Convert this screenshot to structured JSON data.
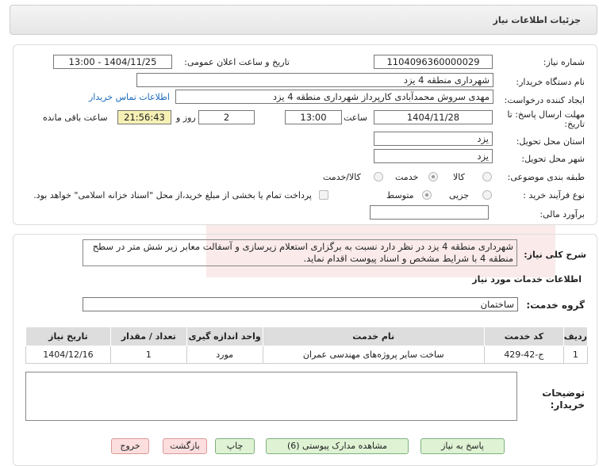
{
  "header": {
    "title": "جزئیات اطلاعات نیاز"
  },
  "form": {
    "need_number_label": "شماره نیاز:",
    "need_number": "1104096360000029",
    "announce_label": "تاریخ و ساعت اعلان عمومی:",
    "announce_value": "1404/11/25 - 13:00",
    "buyer_org_label": "نام دستگاه خریدار:",
    "buyer_org": "شهرداری منطقه 4 یزد",
    "requester_label": "ایجاد کننده درخواست:",
    "requester": "مهدی سروش محمدآبادی کارپرداز شهرداری منطقه 4 یزد",
    "contact_link": "اطلاعات تماس خریدار",
    "deadline_label_1": "مهلت ارسال پاسخ: تا",
    "deadline_label_2": "تاریخ:",
    "deadline_date": "1404/11/28",
    "time_label": "ساعت",
    "deadline_time": "13:00",
    "days_value": "2",
    "days_label": "روز و",
    "remaining_time": "21:56:43",
    "remaining_label": "ساعت باقی مانده",
    "province_label": "استان محل تحویل:",
    "province": "یزد",
    "city_label": "شهر محل تحویل:",
    "city": "یزد",
    "category_label": "طبقه بندی موضوعی:",
    "category_options": [
      "کالا",
      "خدمت",
      "کالا/خدمت"
    ],
    "category_selected": "خدمت",
    "process_label": "نوع فرآیند خرید :",
    "process_options": [
      "جزیی",
      "متوسط"
    ],
    "process_selected": "متوسط",
    "payment_note": "پرداخت تمام یا بخشی از مبلغ خرید،از محل \"اسناد خزانه اسلامی\" خواهد بود.",
    "budget_label": "برآورد مالی:",
    "budget": ""
  },
  "details": {
    "summary_label": "شرح کلی نیاز:",
    "summary": "شهرداری منطقه 4 یزد در نظر دارد نسبت به برگزاری استعلام زیرسازی و آسفالت معابر زیر شش متر در سطح منطقه 4 با شرایط مشخص و اسناد پیوست اقدام نماید.",
    "services_heading": "اطلاعات خدمات مورد نیاز",
    "service_group_label": "گروه خدمت:",
    "service_group": "ساختمان",
    "table": {
      "headers": [
        "ردیف",
        "کد خدمت",
        "نام خدمت",
        "واحد اندازه گیری",
        "تعداد / مقدار",
        "تاریخ نیاز"
      ],
      "rows": [
        [
          "1",
          "ج-42-429",
          "ساخت سایر پروژه‌های مهندسی عمران",
          "مورد",
          "1",
          "1404/12/16"
        ]
      ]
    },
    "buyer_notes_label_1": "توضیحات",
    "buyer_notes_label_2": "خریدار:",
    "buyer_notes": ""
  },
  "buttons": {
    "reply": "پاسخ به نیاز",
    "attachments": "مشاهده مدارک پیوستی (6)",
    "print": "چاپ",
    "back": "بازگشت",
    "exit": "خروج"
  }
}
